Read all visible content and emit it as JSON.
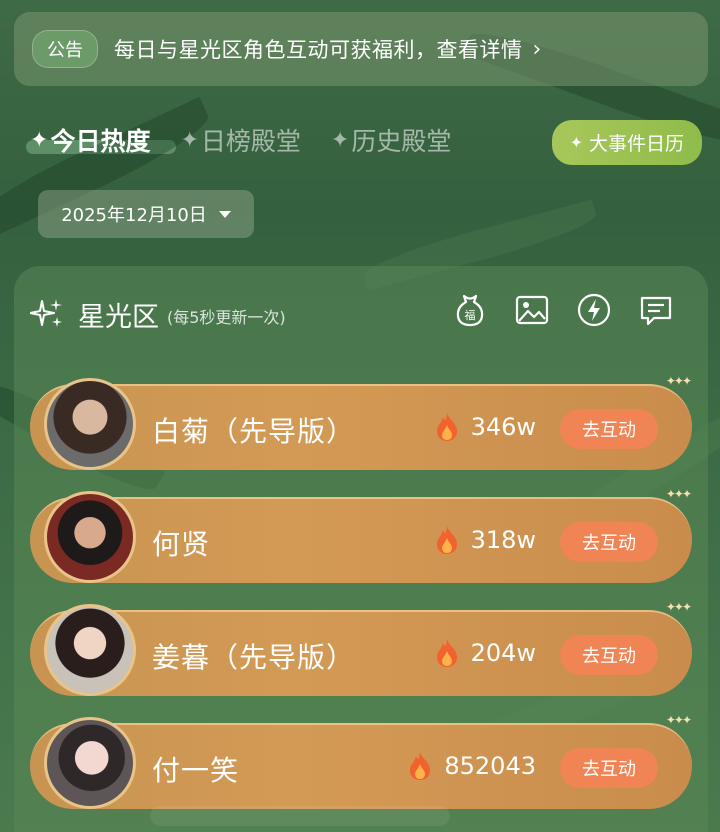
{
  "announcement": {
    "tag": "公告",
    "text": "每日与星光区角色互动可获福利，查看详情",
    "chevron": "›"
  },
  "tabs": [
    {
      "label": "今日热度",
      "active": true
    },
    {
      "label": "日榜殿堂",
      "active": false
    },
    {
      "label": "历史殿堂",
      "active": false
    }
  ],
  "calendar_button": {
    "label": "大事件日历",
    "icon": "sparkle-icon"
  },
  "date_selector": {
    "value": "2025年12月10日"
  },
  "panel": {
    "title": "星光区",
    "subtitle": "(每5秒更新一次)",
    "icons": [
      "fortune-bag-icon",
      "image-icon",
      "lightning-icon",
      "message-icon"
    ],
    "fortune_glyph": "福"
  },
  "rows": [
    {
      "name": "白菊（先导版）",
      "heat": "346w",
      "action": "去互动"
    },
    {
      "name": "何贤",
      "heat": "318w",
      "action": "去互动"
    },
    {
      "name": "姜暮（先导版）",
      "heat": "204w",
      "action": "去互动"
    },
    {
      "name": "付一笑",
      "heat": "852043",
      "action": "去互动"
    }
  ],
  "colors": {
    "accent_orange": "#f08454",
    "row_gold": "#d39a55",
    "calendar_green": "#9cc250"
  }
}
